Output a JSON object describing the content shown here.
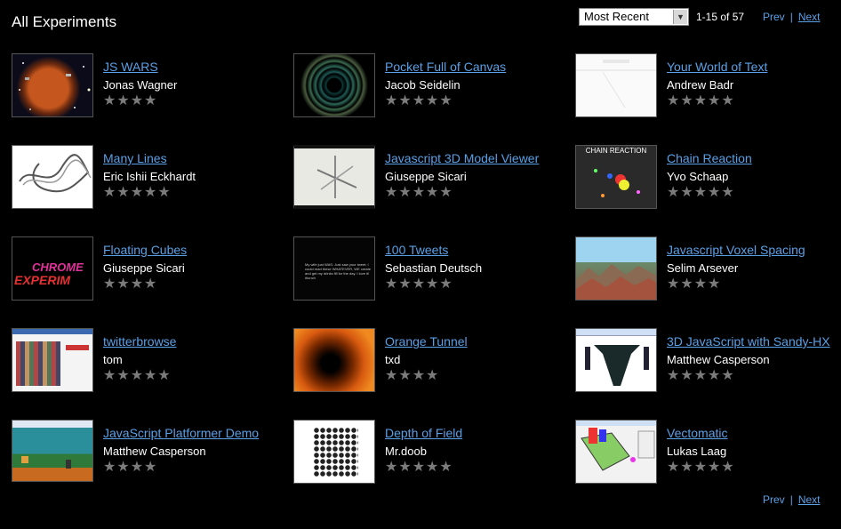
{
  "header": {
    "title": "All Experiments",
    "sort_selected": "Most Recent",
    "range": "1-15 of 57",
    "prev": "Prev",
    "separator": "|",
    "next": "Next"
  },
  "experiments": [
    {
      "title": "JS WARS",
      "author": "Jonas Wagner",
      "stars": "★★★★",
      "thumb": "space-planet"
    },
    {
      "title": "Pocket Full of Canvas",
      "author": "Jacob Seidelin",
      "stars": "★★★★★",
      "thumb": "tunnel-dots"
    },
    {
      "title": "Your World of Text",
      "author": "Andrew Badr",
      "stars": "★★★★★",
      "thumb": "white-page"
    },
    {
      "title": "Many Lines",
      "author": "Eric Ishii Eckhardt",
      "stars": "★★★★★",
      "thumb": "scribble"
    },
    {
      "title": "Javascript 3D Model Viewer",
      "author": "Giuseppe Sicari",
      "stars": "★★★★★",
      "thumb": "model"
    },
    {
      "title": "Chain Reaction",
      "author": "Yvo Schaap",
      "stars": "★★★★★",
      "thumb": "chain"
    },
    {
      "title": "Floating Cubes",
      "author": "Giuseppe Sicari",
      "stars": "★★★★",
      "thumb": "cubes"
    },
    {
      "title": "100 Tweets",
      "author": "Sebastian Deutsch",
      "stars": "★★★★★",
      "thumb": "tweets"
    },
    {
      "title": "Javascript Voxel Spacing",
      "author": "Selim Arsever",
      "stars": "★★★★",
      "thumb": "voxel"
    },
    {
      "title": "twitterbrowse",
      "author": "tom",
      "stars": "★★★★★",
      "thumb": "browse"
    },
    {
      "title": "Orange Tunnel",
      "author": "txd",
      "stars": "★★★★",
      "thumb": "orange"
    },
    {
      "title": "3D JavaScript with Sandy-HX",
      "author": "Matthew Casperson",
      "stars": "★★★★★",
      "thumb": "sandy"
    },
    {
      "title": "JavaScript Platformer Demo",
      "author": "Matthew Casperson",
      "stars": "★★★★",
      "thumb": "platformer"
    },
    {
      "title": "Depth of Field",
      "author": "Mr.doob",
      "stars": "★★★★★",
      "thumb": "spheres"
    },
    {
      "title": "Vectomatic",
      "author": "Lukas Laag",
      "stars": "★★★★★",
      "thumb": "vectomatic"
    }
  ],
  "thumb_text": {
    "chain": "CHAIN REACTION",
    "cubes_1": "CHROME",
    "cubes_2": "EXPERIM",
    "tweets": "My wife just WAS: Just saw your tweet; I could read these WHATEVER, WE create and get my drinks fill for the day. I love it! #lunch"
  }
}
